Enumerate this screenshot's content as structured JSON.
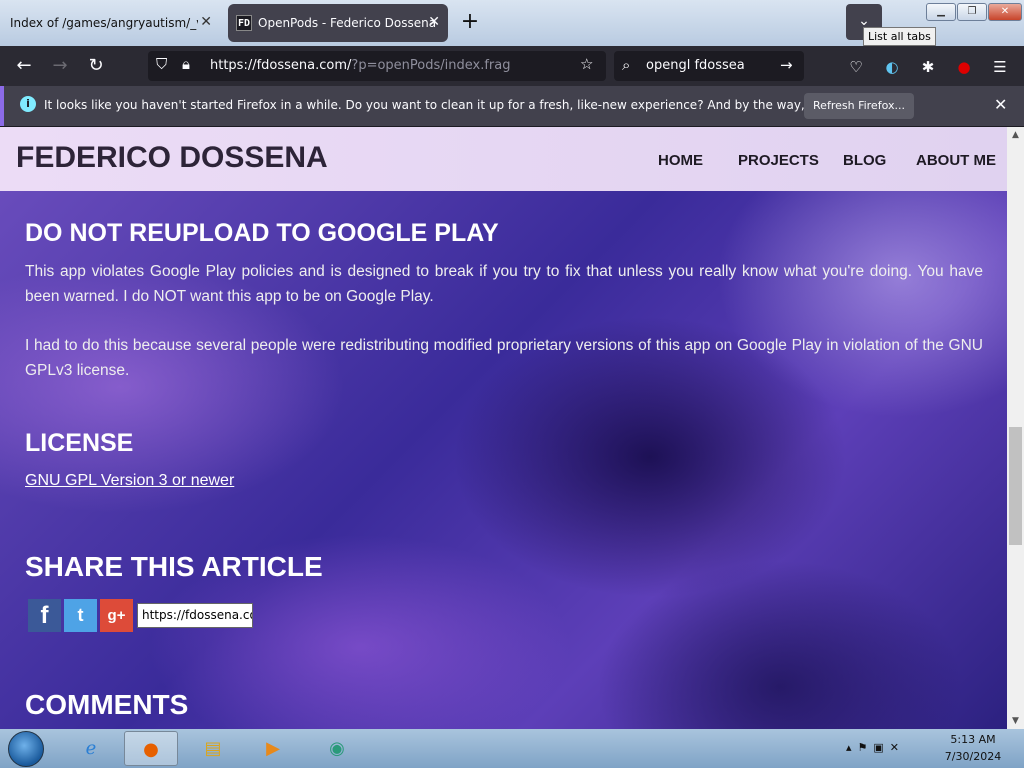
{
  "browser": {
    "tabs": [
      {
        "title": "Index of /games/angryautism/_vani",
        "active": false
      },
      {
        "title": "OpenPods - Federico Dossena",
        "active": true,
        "favicon_text": "FD"
      }
    ],
    "list_tabs_tooltip": "List all tabs",
    "url": {
      "domain": "https://fdossena.com/",
      "path": "?p=openPods/index.frag"
    },
    "search_text": "opengl fdossea",
    "notification": {
      "text": "It looks like you haven't started Firefox in a while. Do you want to clean it up for a fresh, like-new experience? And by the way, welcome back!",
      "button": "Refresh Firefox..."
    }
  },
  "site": {
    "title": "FEDERICO DOSSENA",
    "nav": [
      "HOME",
      "PROJECTS",
      "BLOG",
      "ABOUT ME"
    ]
  },
  "article": {
    "section1": {
      "heading": "DO NOT REUPLOAD TO GOOGLE PLAY",
      "para1": "This app violates Google Play policies and is designed to break if you try to fix that unless you really know what you're doing. You have been warned. I do NOT want this app to be on Google Play.",
      "para2": "I had to do this because several people were redistributing modified proprietary versions of this app on Google Play in violation of the GNU GPLv3 license."
    },
    "license": {
      "heading": "LICENSE",
      "link": "GNU GPL Version 3 or newer"
    },
    "share": {
      "heading": "SHARE THIS ARTICLE",
      "url_value": "https://fdossena.com/?p=openPods/index.frag",
      "fb": "f",
      "tw": "t",
      "gp": "g+"
    },
    "comments": {
      "heading": "COMMENTS"
    }
  },
  "taskbar": {
    "time": "5:13 AM",
    "date": "7/30/2024"
  },
  "colors": {
    "accent": "#8c6be8",
    "toolbar": "#2b2a33",
    "tab_active": "#42414d"
  }
}
